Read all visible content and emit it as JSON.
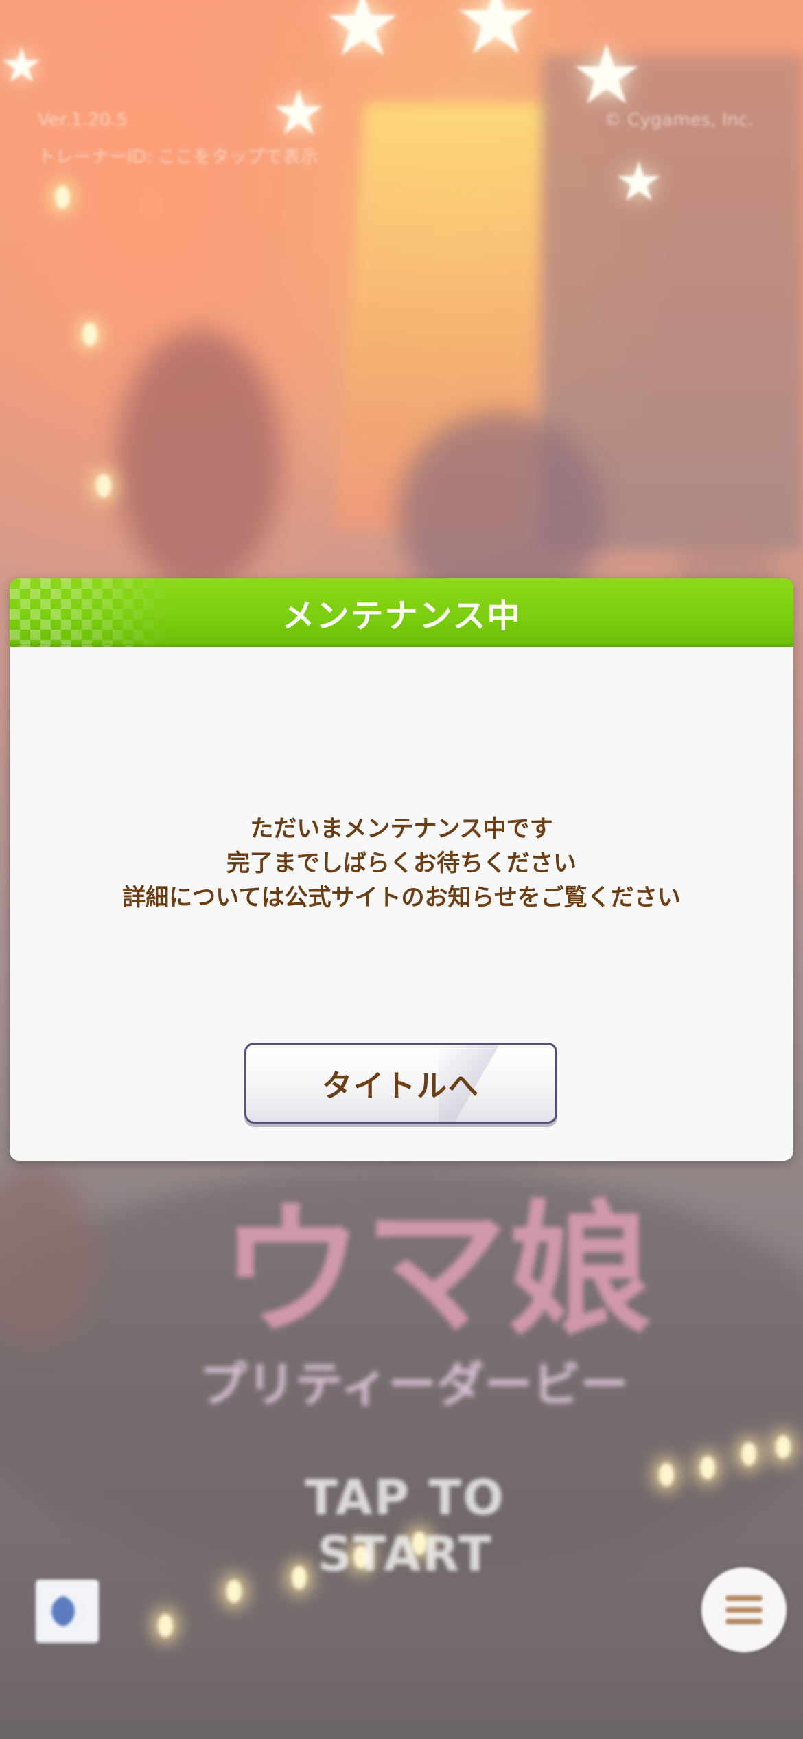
{
  "top_info": {
    "version": "Ver.1.20.5",
    "trainer_id": "トレーナーID: ここをタップで表示",
    "copyright": "© Cygames, Inc."
  },
  "logo": {
    "main": "ウマ娘",
    "sub": "プリティーダービー"
  },
  "tap_to_start": "TAP TO START",
  "dialog": {
    "title": "メンテナンス中",
    "message_lines": [
      "ただいまメンテナンス中です",
      "完了までしばらくお待ちください",
      "詳細については公式サイトのお知らせをご覧ください"
    ],
    "button_label": "タイトルへ",
    "header_color": "#7cce10",
    "text_color": "#6b3e16"
  },
  "icons": {
    "corner_badge": "moon-badge-icon",
    "menu": "hamburger-menu-icon"
  }
}
